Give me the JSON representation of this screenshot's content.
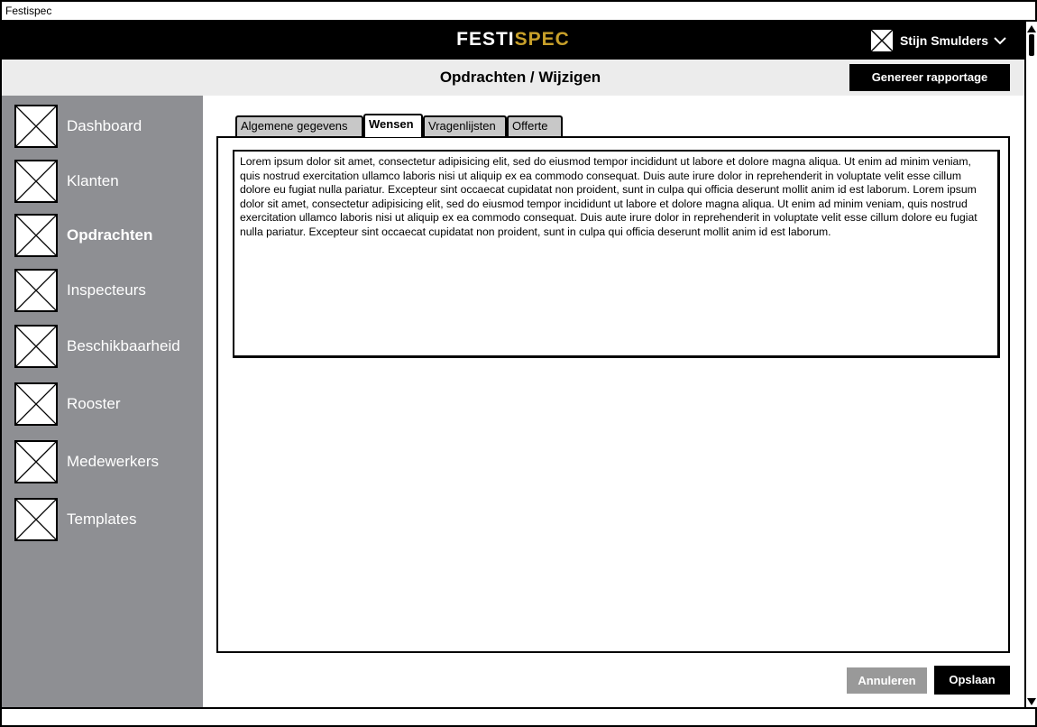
{
  "window": {
    "title": "Festispec"
  },
  "header": {
    "brand_part1": "FESTI",
    "brand_part2": "SPEC",
    "brand_colors": {
      "primary": "#ffffff",
      "accent": "#c8a02a"
    },
    "user_name": "Stijn Smulders",
    "user_icon": "avatar-placeholder-icon",
    "user_menu_icon": "chevron-down-icon"
  },
  "subheader": {
    "page_title": "Opdrachten / Wijzigen",
    "generate_report_label": "Genereer rapportage"
  },
  "sidebar": {
    "items": [
      {
        "label": "Dashboard",
        "icon": "dashboard-placeholder-icon",
        "active": false
      },
      {
        "label": "Klanten",
        "icon": "klanten-placeholder-icon",
        "active": false
      },
      {
        "label": "Opdrachten",
        "icon": "opdrachten-placeholder-icon",
        "active": true
      },
      {
        "label": "Inspecteurs",
        "icon": "inspecteurs-placeholder-icon",
        "active": false
      },
      {
        "label": "Beschikbaarheid",
        "icon": "beschikbaarheid-placeholder-icon",
        "active": false
      },
      {
        "label": "Rooster",
        "icon": "rooster-placeholder-icon",
        "active": false
      },
      {
        "label": "Medewerkers",
        "icon": "medewerkers-placeholder-icon",
        "active": false
      },
      {
        "label": "Templates",
        "icon": "templates-placeholder-icon",
        "active": false
      }
    ]
  },
  "main": {
    "tabs": [
      {
        "label": "Algemene gegevens",
        "active": false
      },
      {
        "label": "Wensen",
        "active": true
      },
      {
        "label": "Vragenlijsten",
        "active": false
      },
      {
        "label": "Offerte",
        "active": false
      }
    ],
    "wensen_text": "Lorem ipsum dolor sit amet, consectetur adipisicing elit, sed do eiusmod tempor incididunt ut labore et dolore magna aliqua. Ut enim ad minim veniam, quis nostrud exercitation ullamco laboris nisi ut aliquip ex ea commodo consequat. Duis aute irure dolor in reprehenderit in voluptate velit esse cillum dolore eu fugiat nulla pariatur. Excepteur sint occaecat cupidatat non proident, sunt in culpa qui officia deserunt mollit anim id est laborum. Lorem ipsum dolor sit amet, consectetur adipisicing elit, sed do eiusmod tempor incididunt ut labore et dolore magna aliqua. Ut enim ad minim veniam, quis nostrud exercitation ullamco laboris nisi ut aliquip ex ea commodo consequat. Duis aute irure dolor in reprehenderit in voluptate velit esse cillum dolore eu fugiat nulla pariatur. Excepteur sint occaecat cupidatat non proident, sunt in culpa qui officia deserunt mollit anim id est laborum.",
    "cancel_label": "Annuleren",
    "save_label": "Opslaan"
  }
}
